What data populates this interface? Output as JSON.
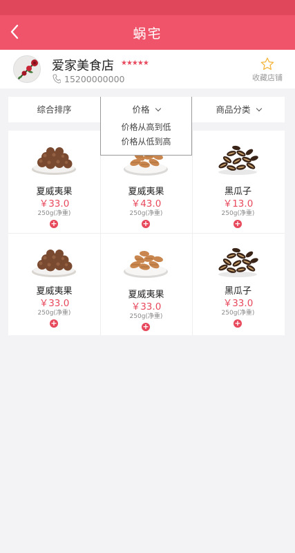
{
  "header": {
    "title": "蜗宅",
    "back_icon": "chevron-left-icon"
  },
  "colors": {
    "brand": "#f0546a",
    "price": "#e8485c"
  },
  "shop": {
    "name": "爱家美食店",
    "rating_stars": "★★★★★",
    "rating": 5,
    "phone": "15200000000",
    "favorite_label": "收藏店铺"
  },
  "filters": [
    {
      "label": "综合排序"
    },
    {
      "label": "价格"
    },
    {
      "label": "商品分类"
    }
  ],
  "price_dropdown": {
    "options": [
      "价格从高到低",
      "价格从低到高"
    ]
  },
  "products": [
    {
      "name": "夏威夷果",
      "price": "￥33.0",
      "weight": "250g(净重)",
      "image": "macadamia"
    },
    {
      "name": "夏威夷果",
      "price": "￥43.0",
      "weight": "250g(净重)",
      "image": "almond"
    },
    {
      "name": "黑瓜子",
      "price": "￥13.0",
      "weight": "250g(净重)",
      "image": "watermelon-seeds"
    },
    {
      "name": "夏威夷果",
      "price": "￥33.0",
      "weight": "250g(净重)",
      "image": "macadamia"
    },
    {
      "name": "夏威夷果",
      "price": "￥33.0",
      "weight": "250g(净重)",
      "image": "almond"
    },
    {
      "name": "黑瓜子",
      "price": "￥33.0",
      "weight": "250g(净重)",
      "image": "watermelon-seeds"
    }
  ]
}
